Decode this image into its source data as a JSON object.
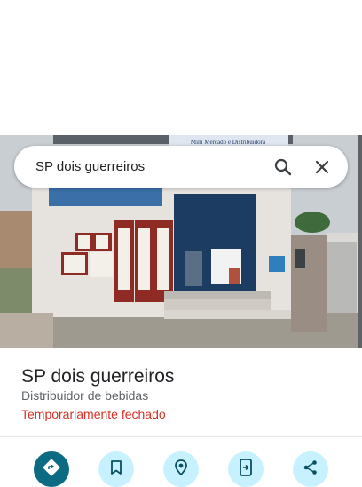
{
  "search": {
    "query": "SP dois guerreiros",
    "search_icon": "search-icon",
    "close_icon": "close-icon"
  },
  "photo": {
    "sign_text": "Mini Mercado e Distribuidora"
  },
  "place": {
    "name": "SP dois guerreiros",
    "category": "Distribuidor de bebidas",
    "status": "Temporariamente fechado",
    "status_color": "#d93025"
  },
  "actions": [
    {
      "icon": "directions-icon"
    },
    {
      "icon": "bookmark-icon"
    },
    {
      "icon": "nearby-location-icon"
    },
    {
      "icon": "send-to-phone-icon"
    },
    {
      "icon": "share-icon"
    }
  ],
  "colors": {
    "primary_action": "#0b6b83",
    "secondary_action": "#c7f1ff"
  }
}
